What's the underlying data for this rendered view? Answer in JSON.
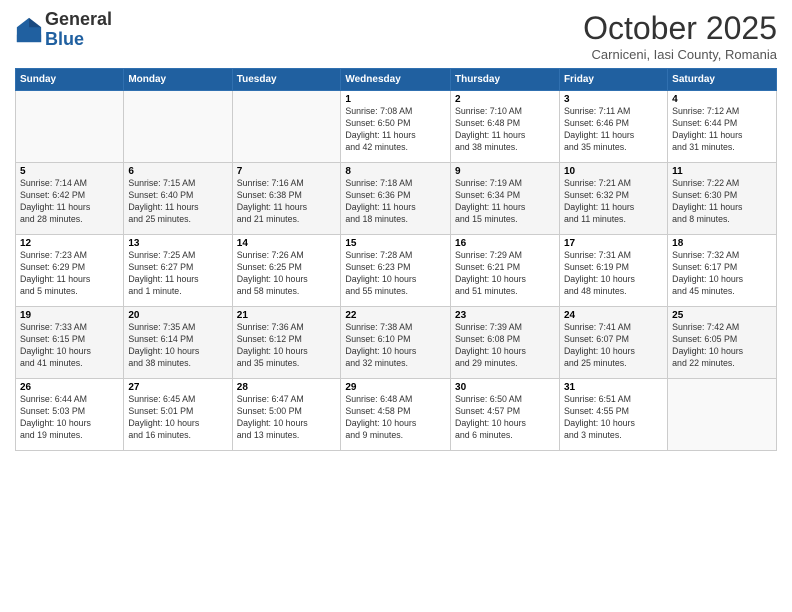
{
  "header": {
    "logo_general": "General",
    "logo_blue": "Blue",
    "month": "October 2025",
    "location": "Carniceni, Iasi County, Romania"
  },
  "weekdays": [
    "Sunday",
    "Monday",
    "Tuesday",
    "Wednesday",
    "Thursday",
    "Friday",
    "Saturday"
  ],
  "weeks": [
    [
      {
        "day": "",
        "info": ""
      },
      {
        "day": "",
        "info": ""
      },
      {
        "day": "",
        "info": ""
      },
      {
        "day": "1",
        "info": "Sunrise: 7:08 AM\nSunset: 6:50 PM\nDaylight: 11 hours\nand 42 minutes."
      },
      {
        "day": "2",
        "info": "Sunrise: 7:10 AM\nSunset: 6:48 PM\nDaylight: 11 hours\nand 38 minutes."
      },
      {
        "day": "3",
        "info": "Sunrise: 7:11 AM\nSunset: 6:46 PM\nDaylight: 11 hours\nand 35 minutes."
      },
      {
        "day": "4",
        "info": "Sunrise: 7:12 AM\nSunset: 6:44 PM\nDaylight: 11 hours\nand 31 minutes."
      }
    ],
    [
      {
        "day": "5",
        "info": "Sunrise: 7:14 AM\nSunset: 6:42 PM\nDaylight: 11 hours\nand 28 minutes."
      },
      {
        "day": "6",
        "info": "Sunrise: 7:15 AM\nSunset: 6:40 PM\nDaylight: 11 hours\nand 25 minutes."
      },
      {
        "day": "7",
        "info": "Sunrise: 7:16 AM\nSunset: 6:38 PM\nDaylight: 11 hours\nand 21 minutes."
      },
      {
        "day": "8",
        "info": "Sunrise: 7:18 AM\nSunset: 6:36 PM\nDaylight: 11 hours\nand 18 minutes."
      },
      {
        "day": "9",
        "info": "Sunrise: 7:19 AM\nSunset: 6:34 PM\nDaylight: 11 hours\nand 15 minutes."
      },
      {
        "day": "10",
        "info": "Sunrise: 7:21 AM\nSunset: 6:32 PM\nDaylight: 11 hours\nand 11 minutes."
      },
      {
        "day": "11",
        "info": "Sunrise: 7:22 AM\nSunset: 6:30 PM\nDaylight: 11 hours\nand 8 minutes."
      }
    ],
    [
      {
        "day": "12",
        "info": "Sunrise: 7:23 AM\nSunset: 6:29 PM\nDaylight: 11 hours\nand 5 minutes."
      },
      {
        "day": "13",
        "info": "Sunrise: 7:25 AM\nSunset: 6:27 PM\nDaylight: 11 hours\nand 1 minute."
      },
      {
        "day": "14",
        "info": "Sunrise: 7:26 AM\nSunset: 6:25 PM\nDaylight: 10 hours\nand 58 minutes."
      },
      {
        "day": "15",
        "info": "Sunrise: 7:28 AM\nSunset: 6:23 PM\nDaylight: 10 hours\nand 55 minutes."
      },
      {
        "day": "16",
        "info": "Sunrise: 7:29 AM\nSunset: 6:21 PM\nDaylight: 10 hours\nand 51 minutes."
      },
      {
        "day": "17",
        "info": "Sunrise: 7:31 AM\nSunset: 6:19 PM\nDaylight: 10 hours\nand 48 minutes."
      },
      {
        "day": "18",
        "info": "Sunrise: 7:32 AM\nSunset: 6:17 PM\nDaylight: 10 hours\nand 45 minutes."
      }
    ],
    [
      {
        "day": "19",
        "info": "Sunrise: 7:33 AM\nSunset: 6:15 PM\nDaylight: 10 hours\nand 41 minutes."
      },
      {
        "day": "20",
        "info": "Sunrise: 7:35 AM\nSunset: 6:14 PM\nDaylight: 10 hours\nand 38 minutes."
      },
      {
        "day": "21",
        "info": "Sunrise: 7:36 AM\nSunset: 6:12 PM\nDaylight: 10 hours\nand 35 minutes."
      },
      {
        "day": "22",
        "info": "Sunrise: 7:38 AM\nSunset: 6:10 PM\nDaylight: 10 hours\nand 32 minutes."
      },
      {
        "day": "23",
        "info": "Sunrise: 7:39 AM\nSunset: 6:08 PM\nDaylight: 10 hours\nand 29 minutes."
      },
      {
        "day": "24",
        "info": "Sunrise: 7:41 AM\nSunset: 6:07 PM\nDaylight: 10 hours\nand 25 minutes."
      },
      {
        "day": "25",
        "info": "Sunrise: 7:42 AM\nSunset: 6:05 PM\nDaylight: 10 hours\nand 22 minutes."
      }
    ],
    [
      {
        "day": "26",
        "info": "Sunrise: 6:44 AM\nSunset: 5:03 PM\nDaylight: 10 hours\nand 19 minutes."
      },
      {
        "day": "27",
        "info": "Sunrise: 6:45 AM\nSunset: 5:01 PM\nDaylight: 10 hours\nand 16 minutes."
      },
      {
        "day": "28",
        "info": "Sunrise: 6:47 AM\nSunset: 5:00 PM\nDaylight: 10 hours\nand 13 minutes."
      },
      {
        "day": "29",
        "info": "Sunrise: 6:48 AM\nSunset: 4:58 PM\nDaylight: 10 hours\nand 9 minutes."
      },
      {
        "day": "30",
        "info": "Sunrise: 6:50 AM\nSunset: 4:57 PM\nDaylight: 10 hours\nand 6 minutes."
      },
      {
        "day": "31",
        "info": "Sunrise: 6:51 AM\nSunset: 4:55 PM\nDaylight: 10 hours\nand 3 minutes."
      },
      {
        "day": "",
        "info": ""
      }
    ]
  ]
}
